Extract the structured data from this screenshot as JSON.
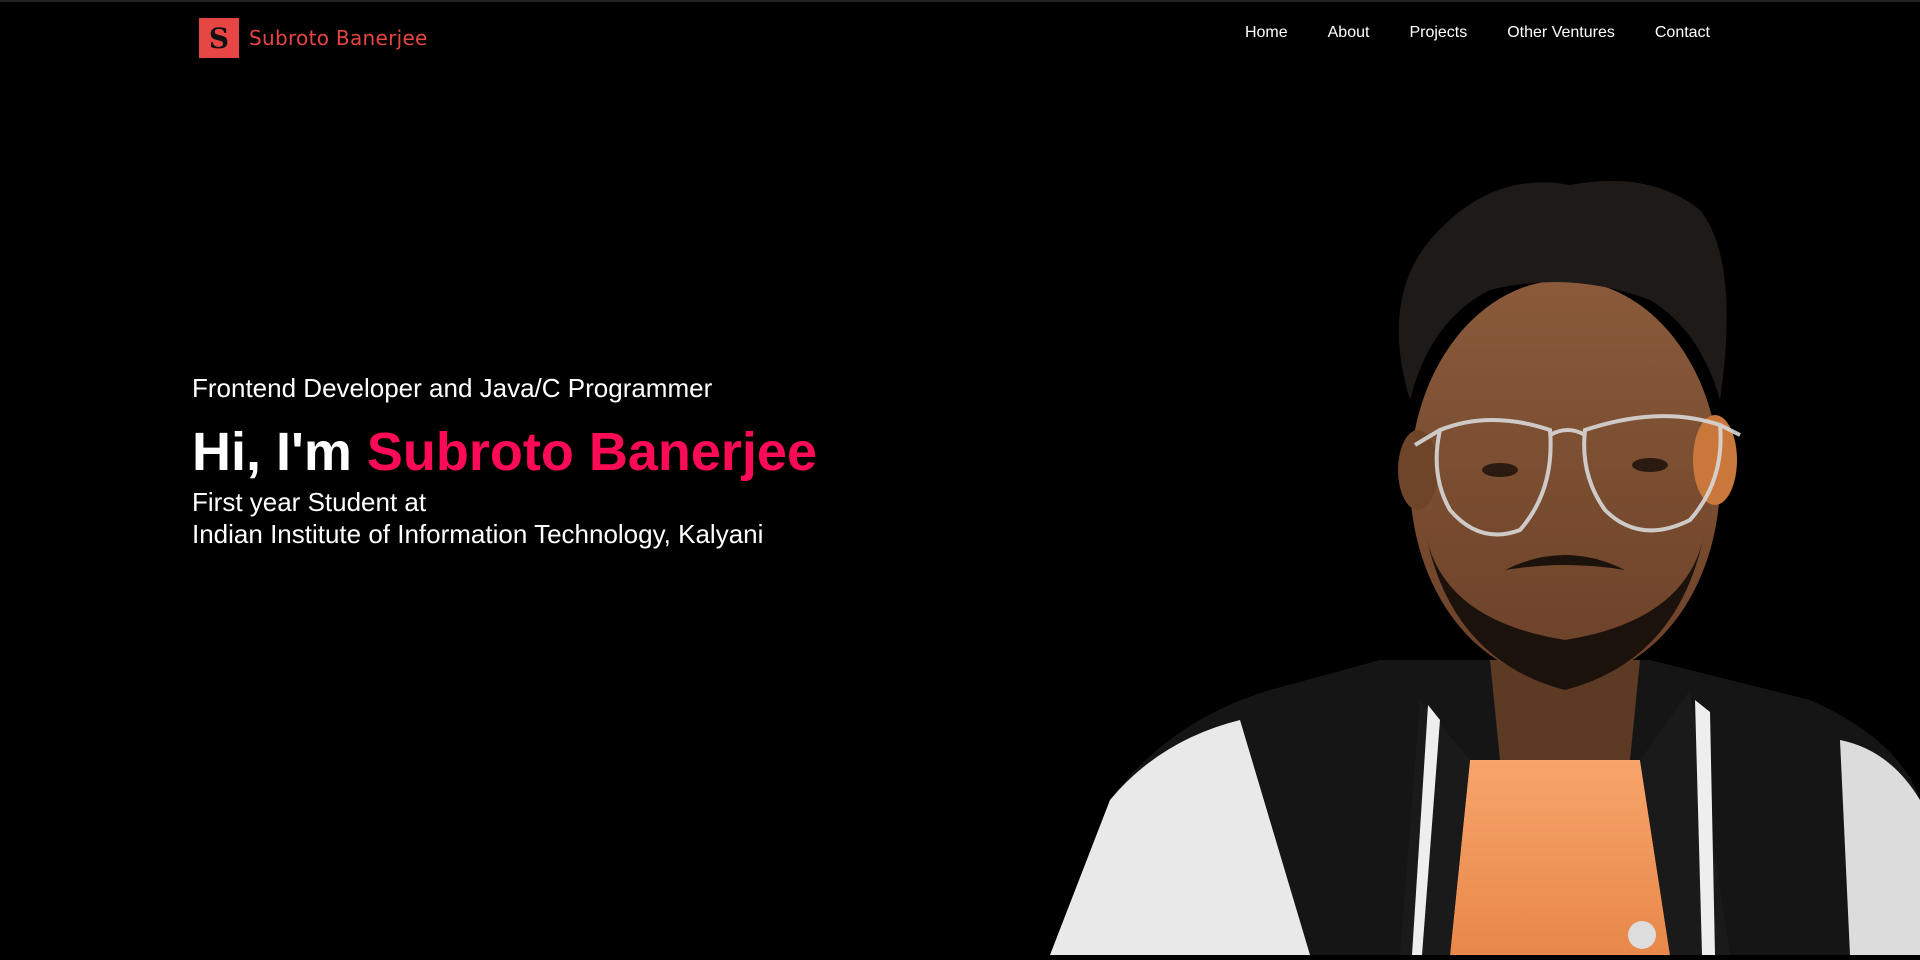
{
  "brand": {
    "logo_letter": "S",
    "name": "Subroto Banerjee",
    "accent_color": "#e84545"
  },
  "nav": {
    "items": [
      {
        "label": "Home"
      },
      {
        "label": "About"
      },
      {
        "label": "Projects"
      },
      {
        "label": "Other Ventures"
      },
      {
        "label": "Contact"
      }
    ]
  },
  "hero": {
    "subtitle": "Frontend Developer and Java/C Programmer",
    "greeting": "Hi, I'm",
    "name": "Subroto Banerjee",
    "line1": "First year Student at",
    "line2": "Indian Institute of Information Technology, Kalyani",
    "name_color": "#ff0a55"
  },
  "portrait": {
    "icon": "portrait-photo"
  }
}
